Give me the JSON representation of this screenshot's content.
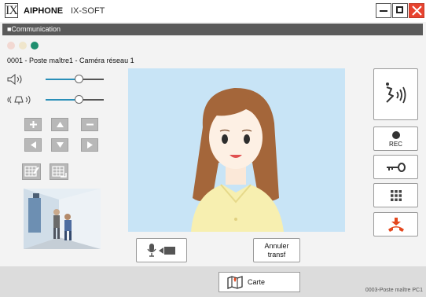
{
  "titlebar": {
    "logo_mark": "IX",
    "brand": "AIPHONE",
    "product": "IX-SOFT"
  },
  "panel": {
    "header": "■Communication"
  },
  "station": {
    "label": "0001 - Poste maître1 - Caméra réseau 1"
  },
  "volume": {
    "speaker_level": 0.58,
    "mic_level": 0.58,
    "speaker_icon": "speaker-volume-icon",
    "mic_icon": "microphone-volume-icon"
  },
  "status_dots": [
    "#f2d8d2",
    "#f0e6cc",
    "#1f8f6f"
  ],
  "buttons": {
    "transfer_line1": "Annuler",
    "transfer_line2": "transf",
    "rec": "REC",
    "map": "Carte"
  },
  "footer": {
    "status": "0003-Poste maître PC1"
  },
  "colors": {
    "close": "#e8432f",
    "end_call": "#e4471e",
    "header_bar": "#5a5a5a"
  }
}
